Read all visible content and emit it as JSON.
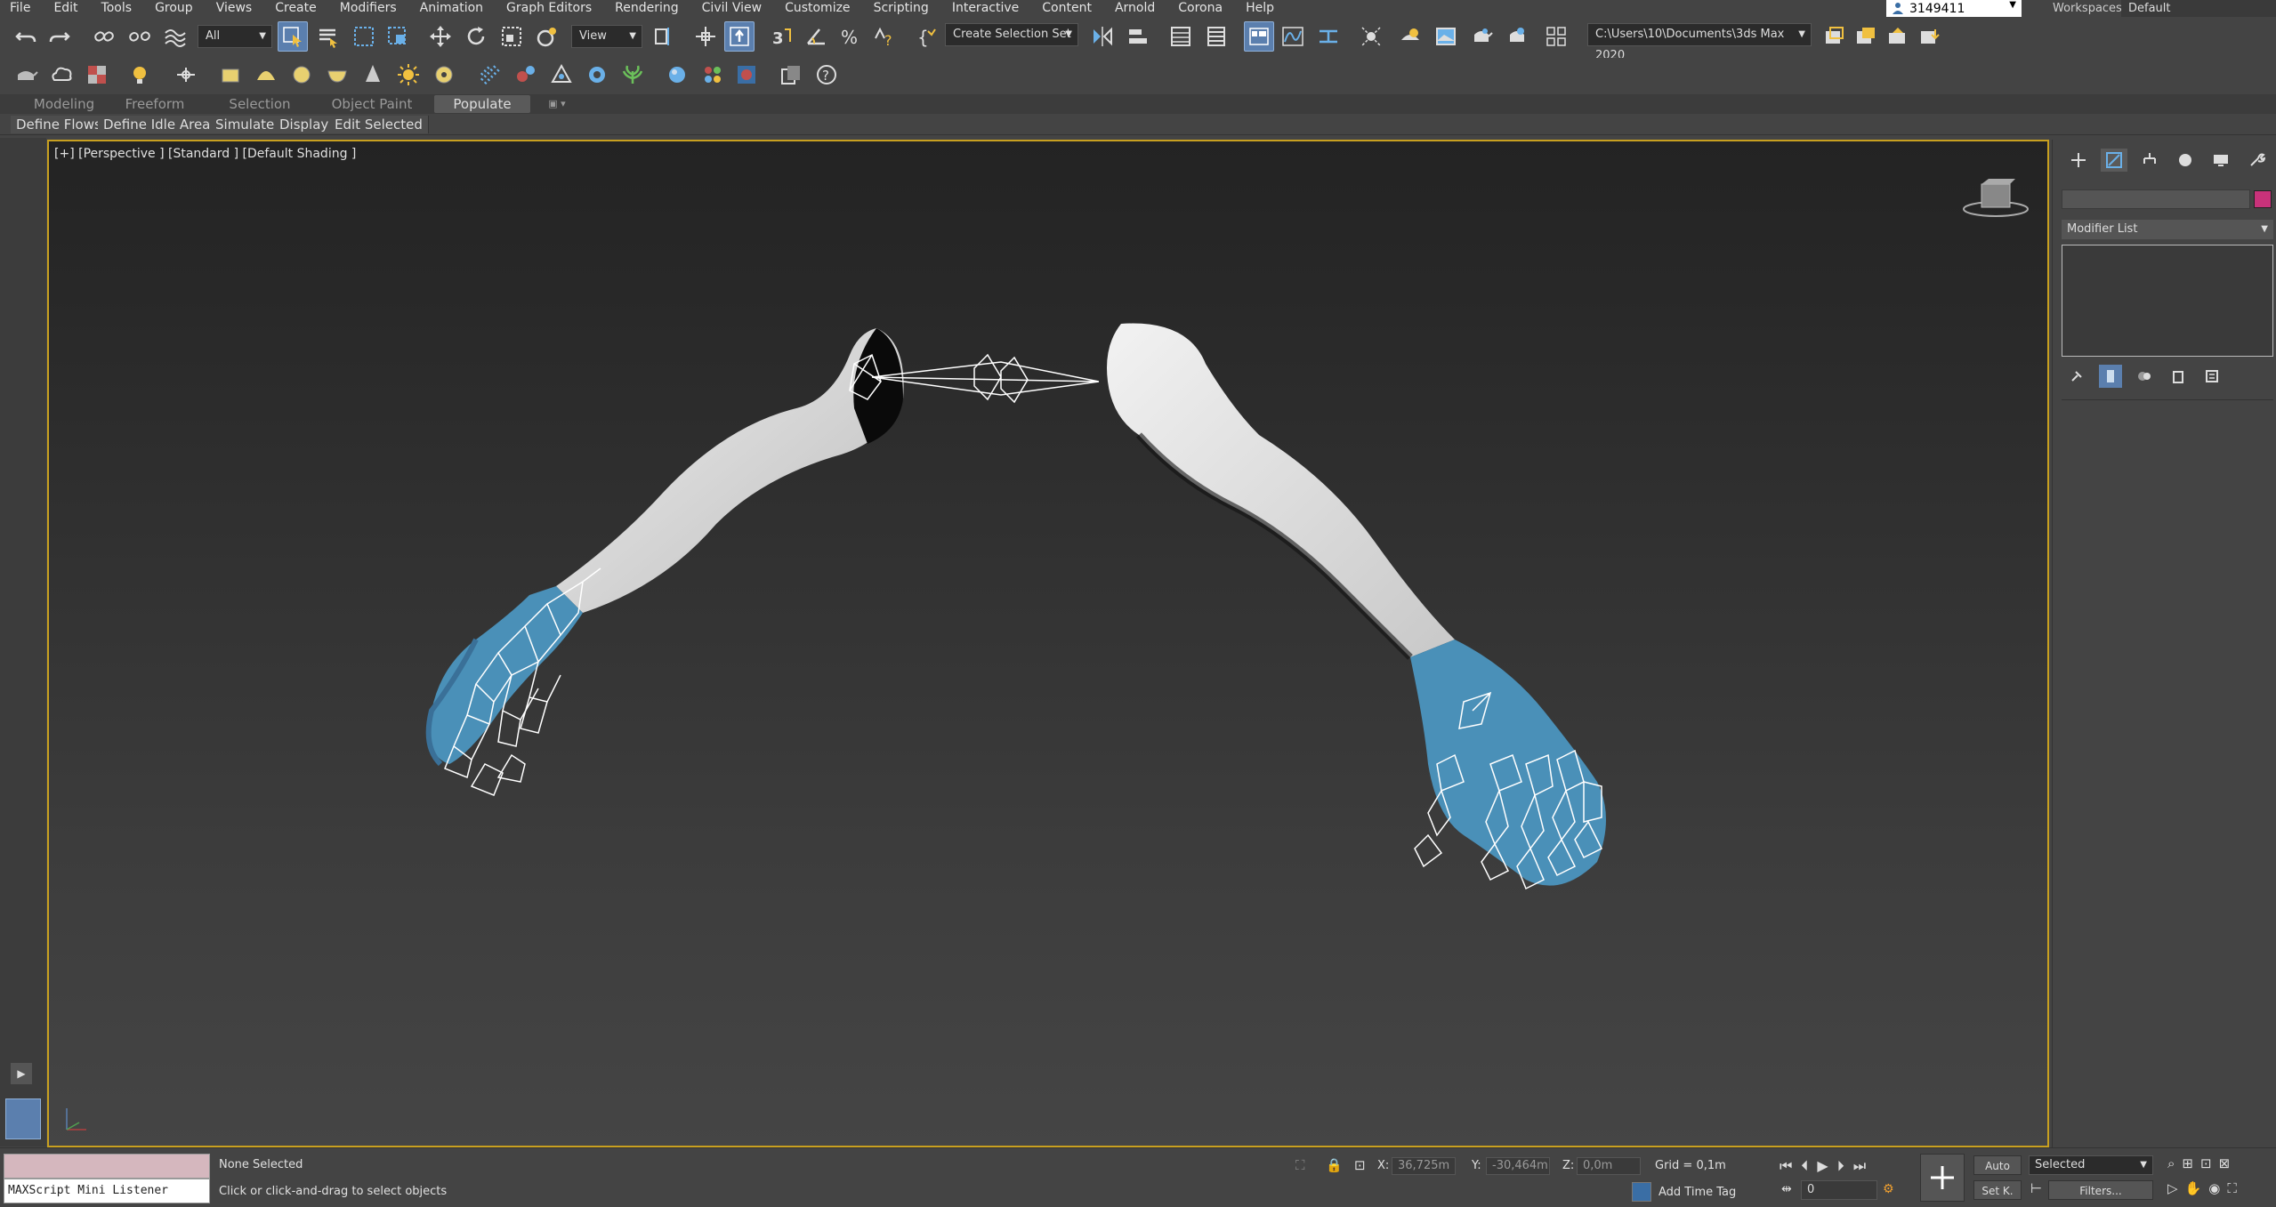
{
  "menu": [
    "File",
    "Edit",
    "Tools",
    "Group",
    "Views",
    "Create",
    "Modifiers",
    "Animation",
    "Graph Editors",
    "Rendering",
    "Civil View",
    "Customize",
    "Scripting",
    "Interactive",
    "Content",
    "Arnold",
    "Corona",
    "Help"
  ],
  "user": {
    "name": "3149411"
  },
  "workspace": {
    "label": "Workspaces:",
    "value": "Default"
  },
  "toolbar": {
    "filter_value": "All",
    "ref_coord_value": "View",
    "selection_set_value": "Create Selection Set",
    "project_path": "C:\\Users\\10\\Documents\\3ds Max 2020"
  },
  "ribbon": {
    "tabs": [
      "Modeling",
      "Freeform",
      "Selection",
      "Object Paint",
      "Populate"
    ],
    "active_tab": "Populate",
    "sub_items": [
      "Define Flows",
      "Define Idle Areas",
      "Simulate",
      "Display",
      "Edit Selected"
    ]
  },
  "viewport": {
    "label": "[+] [Perspective ] [Standard ] [Default Shading ]"
  },
  "command_panel": {
    "modifier_list_label": "Modifier List",
    "object_color": "#c8327a"
  },
  "status": {
    "maxscript_label": "MAXScript Mini Listener",
    "selection_status": "None Selected",
    "prompt": "Click or click-and-drag to select objects",
    "x_label": "X:",
    "x_value": "36,725m",
    "y_label": "Y:",
    "y_value": "-30,464m",
    "z_label": "Z:",
    "z_value": "0,0m",
    "grid": "Grid = 0,1m",
    "add_time_tag": "Add Time Tag",
    "auto_key": "Auto",
    "set_key": "Set K.",
    "selected_dropdown": "Selected",
    "filters": "Filters...",
    "current_frame": "0"
  },
  "colors": {
    "accent": "#5b7fae",
    "viewport_border": "#c8a020",
    "skin_blue": "#4a90b8",
    "arm_grey": "#d8d8d8"
  }
}
